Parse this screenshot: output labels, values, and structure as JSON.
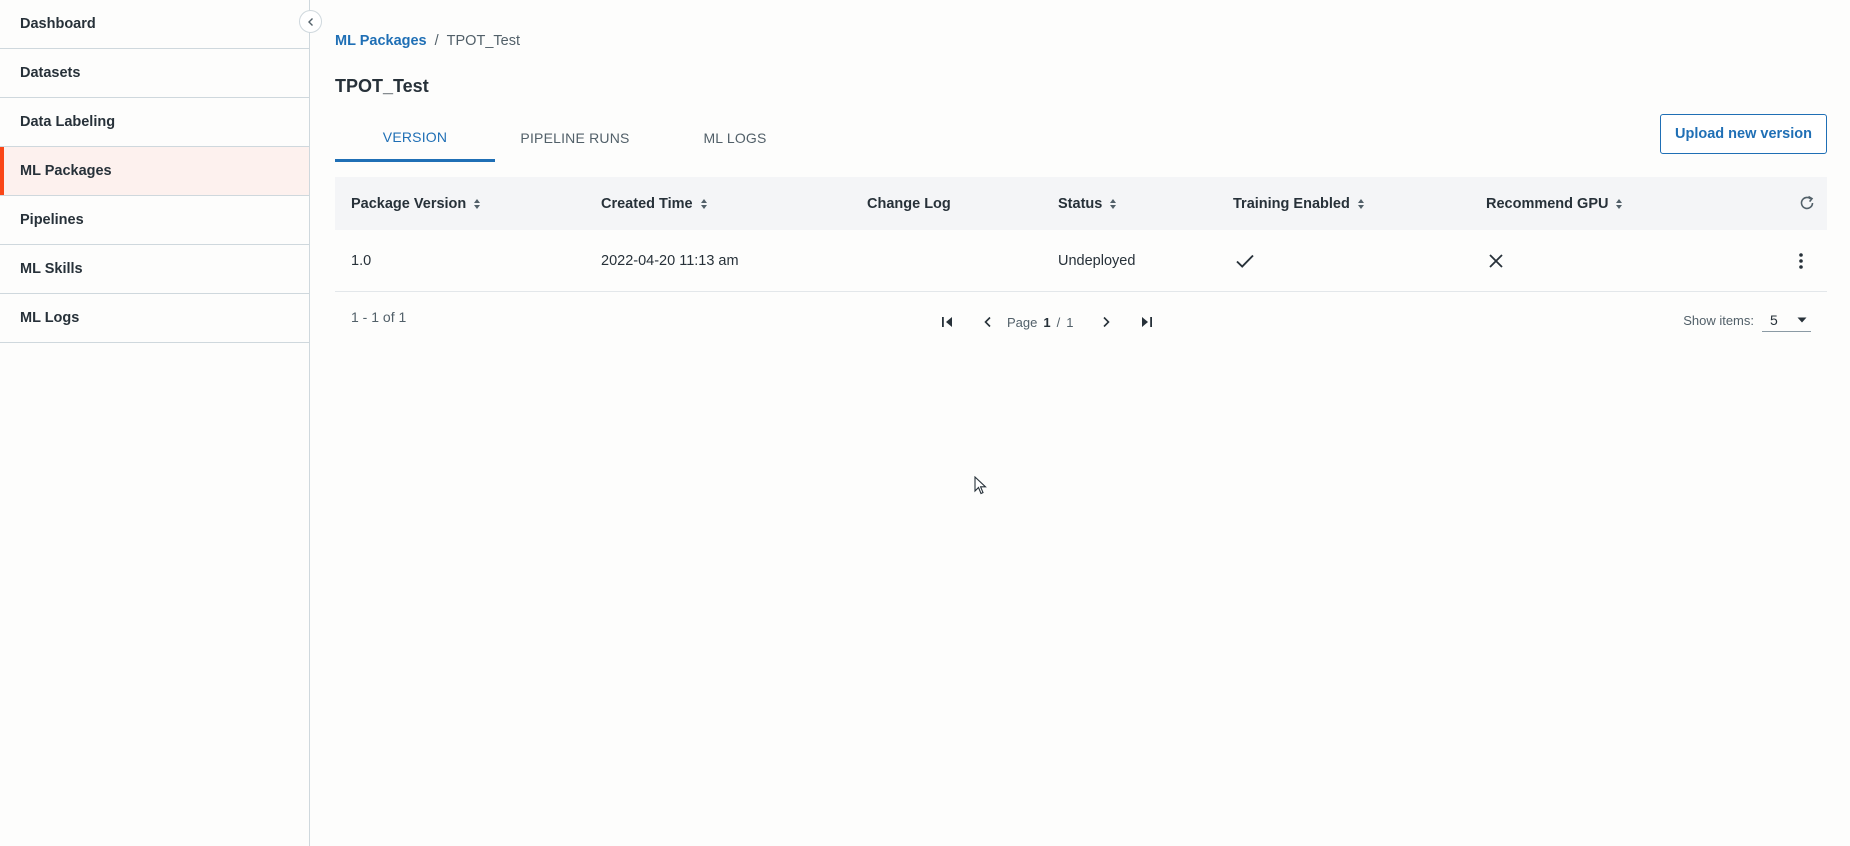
{
  "sidebar": {
    "items": [
      {
        "label": "Dashboard"
      },
      {
        "label": "Datasets"
      },
      {
        "label": "Data Labeling"
      },
      {
        "label": "ML Packages"
      },
      {
        "label": "Pipelines"
      },
      {
        "label": "ML Skills"
      },
      {
        "label": "ML Logs"
      }
    ],
    "active_index": 3
  },
  "breadcrumb": {
    "parent": "ML Packages",
    "separator": "/",
    "current": "TPOT_Test"
  },
  "page": {
    "title": "TPOT_Test"
  },
  "tabs": [
    {
      "label": "VERSION"
    },
    {
      "label": "PIPELINE RUNS"
    },
    {
      "label": "ML LOGS"
    }
  ],
  "toolbar": {
    "upload_label": "Upload new version"
  },
  "table": {
    "columns": [
      {
        "label": "Package Version"
      },
      {
        "label": "Created Time"
      },
      {
        "label": "Change Log"
      },
      {
        "label": "Status"
      },
      {
        "label": "Training Enabled"
      },
      {
        "label": "Recommend GPU"
      }
    ],
    "rows": [
      {
        "package_version": "1.0",
        "created_time": "2022-04-20 11:13 am",
        "change_log": "",
        "status": "Undeployed",
        "training_enabled": "check-icon",
        "recommend_gpu": "close-icon"
      }
    ]
  },
  "pagination": {
    "range": "1 - 1 of 1",
    "page_label": "Page",
    "current_page": "1",
    "separator": "/",
    "total_pages": "1",
    "show_items_label": "Show items:",
    "page_size": "5"
  },
  "colors": {
    "accent": "#1f6fb5",
    "active_marker": "#fa4616",
    "active_bg": "#fdf1ee"
  }
}
